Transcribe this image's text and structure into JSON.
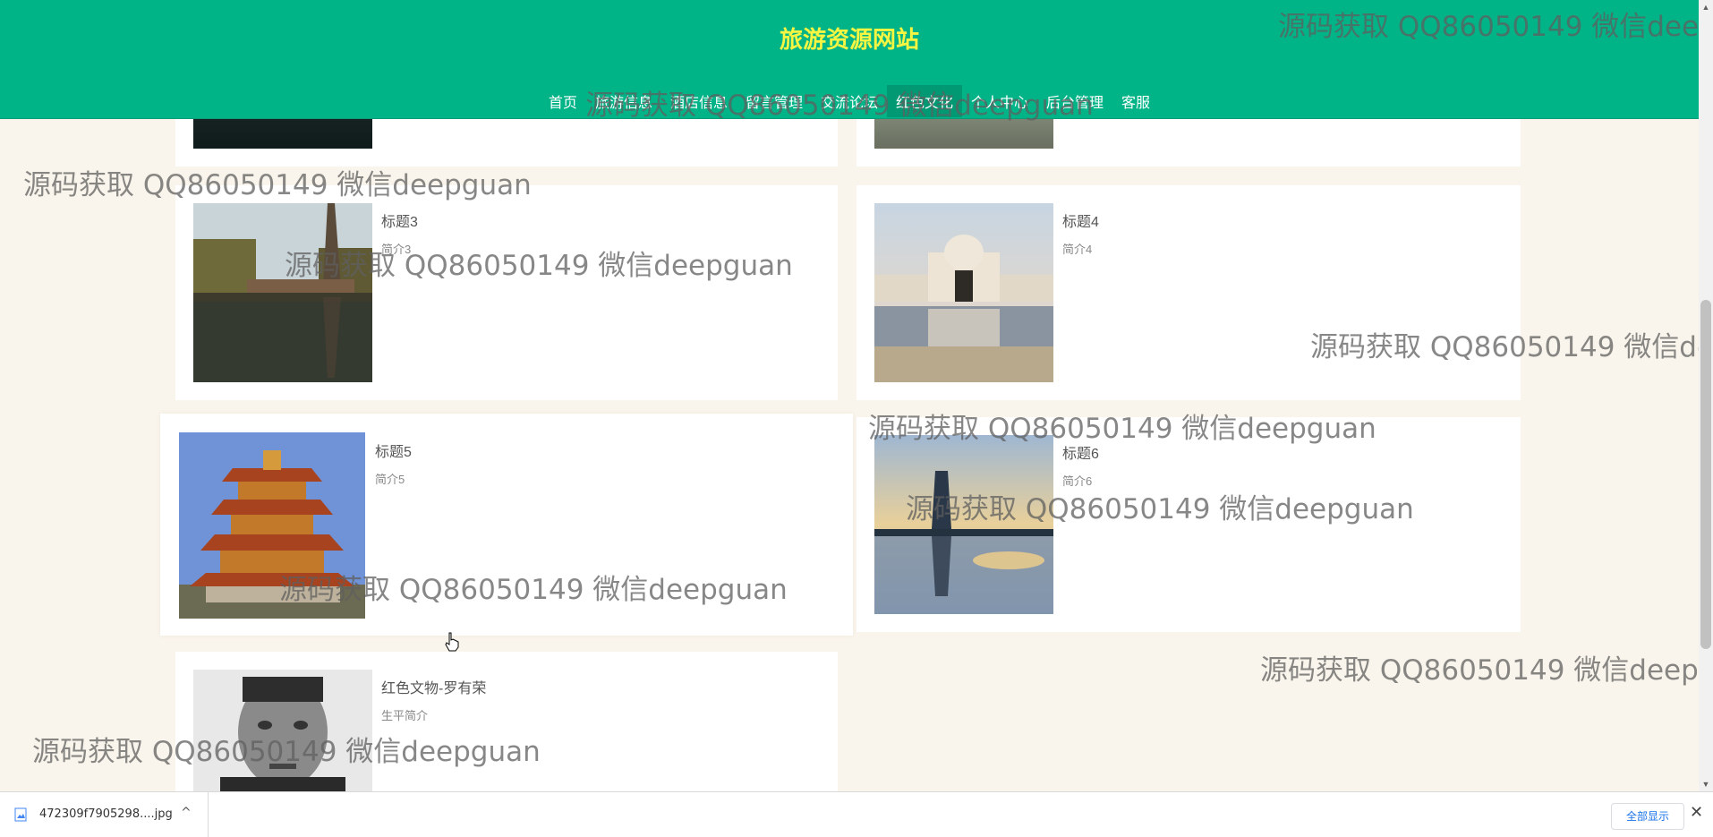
{
  "site": {
    "title": "旅游资源网站"
  },
  "nav": {
    "items": [
      {
        "label": "首页"
      },
      {
        "label": "旅游信息"
      },
      {
        "label": "酒店信息"
      },
      {
        "label": "留言管理"
      },
      {
        "label": "交流论坛"
      },
      {
        "label": "红色文化"
      },
      {
        "label": "个人中心"
      },
      {
        "label": "后台管理"
      },
      {
        "label": "客服"
      }
    ],
    "active_index": 5
  },
  "cards": [
    {
      "title": "标题3",
      "intro": "简介3",
      "image": "pagoda-lake-photo"
    },
    {
      "title": "标题4",
      "intro": "简介4",
      "image": "white-palace-reflection-photo"
    },
    {
      "title": "标题5",
      "intro": "简介5",
      "image": "yellow-crane-tower-photo"
    },
    {
      "title": "标题6",
      "intro": "简介6",
      "image": "pagoda-sunset-reflection-photo"
    },
    {
      "title": "红色文物-罗有荣",
      "intro": "生平简介",
      "image": "portrait-photo"
    }
  ],
  "download_bar": {
    "file_name": "472309f7905298....jpg",
    "show_all_label": "全部显示",
    "close_label": "✕"
  },
  "watermark_text": "源码获取 QQ86050149 微信deepguan",
  "watermark_cut": [
    "源码获取 QQ86050149 微信deepgu",
    "源码获取 QQ86050149 微信deep",
    "源码获取 QQ86050149 微信deepgua"
  ]
}
